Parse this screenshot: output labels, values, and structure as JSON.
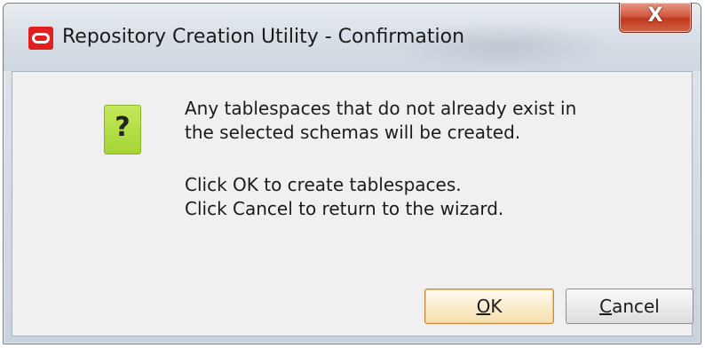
{
  "window": {
    "title": "Repository Creation Utility - Confirmation",
    "close_label": "X",
    "icon": "oracle-logo-icon",
    "accent_color": "#e01f1f"
  },
  "dialog": {
    "icon": "question-icon",
    "icon_glyph": "?",
    "icon_color": "#b5dd47",
    "message_lines": [
      "Any tablespaces that do not already exist in",
      "the selected schemas will be created.",
      "Click OK to create tablespaces.",
      "Click Cancel to return to the wizard."
    ]
  },
  "buttons": {
    "ok": {
      "mnemonic": "O",
      "rest": "K"
    },
    "cancel": {
      "mnemonic": "C",
      "rest": "ancel"
    }
  }
}
